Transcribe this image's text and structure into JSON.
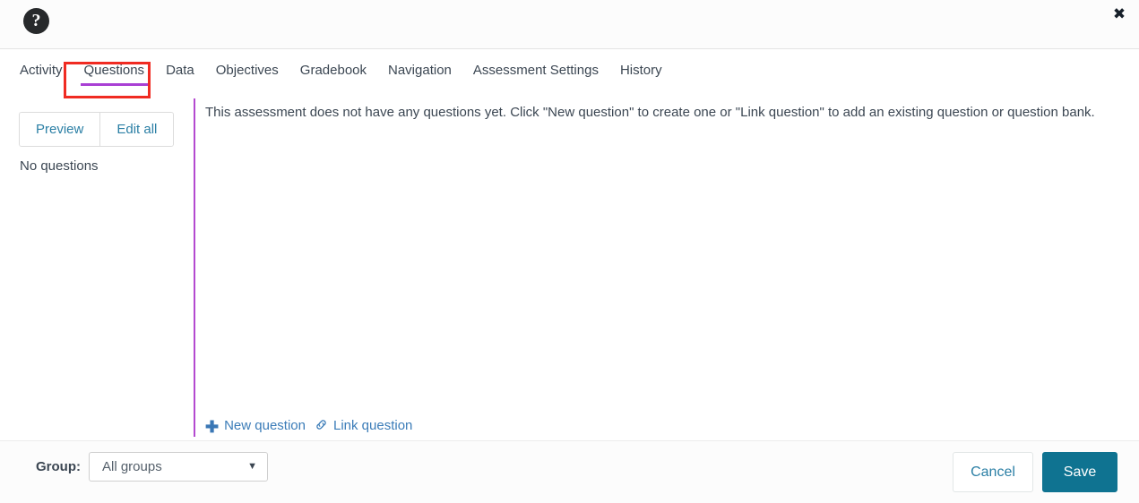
{
  "header": {
    "help_icon": "help-circle-icon",
    "help_glyph": "?",
    "close_icon": "close-icon",
    "close_glyph": "✖"
  },
  "tabs": [
    {
      "label": "Activity",
      "active": false
    },
    {
      "label": "Questions",
      "active": true
    },
    {
      "label": "Data",
      "active": false
    },
    {
      "label": "Objectives",
      "active": false
    },
    {
      "label": "Gradebook",
      "active": false
    },
    {
      "label": "Navigation",
      "active": false
    },
    {
      "label": "Assessment Settings",
      "active": false
    },
    {
      "label": "History",
      "active": false
    }
  ],
  "left_pane": {
    "preview_label": "Preview",
    "edit_all_label": "Edit all",
    "no_questions_text": "No questions"
  },
  "right_pane": {
    "empty_message": "This assessment does not have any questions yet. Click \"New question\" to create one or \"Link question\" to add an existing question or question bank."
  },
  "question_actions": {
    "new_question_label": "New question",
    "new_question_icon": "plus-icon",
    "new_question_glyph": "✚",
    "link_question_label": "Link question",
    "link_question_icon": "chain-link-icon",
    "link_question_glyph": "🔗"
  },
  "footer": {
    "group_label": "Group:",
    "group_value": "All groups",
    "group_caret": "▼",
    "cancel_label": "Cancel",
    "save_label": "Save"
  },
  "colors": {
    "accent_tab_underline": "#a93fd4",
    "divider_purple": "#b44ad0",
    "annotation_red": "#f02b22",
    "save_teal": "#0f7391",
    "link_blue": "#3b7cb8"
  }
}
